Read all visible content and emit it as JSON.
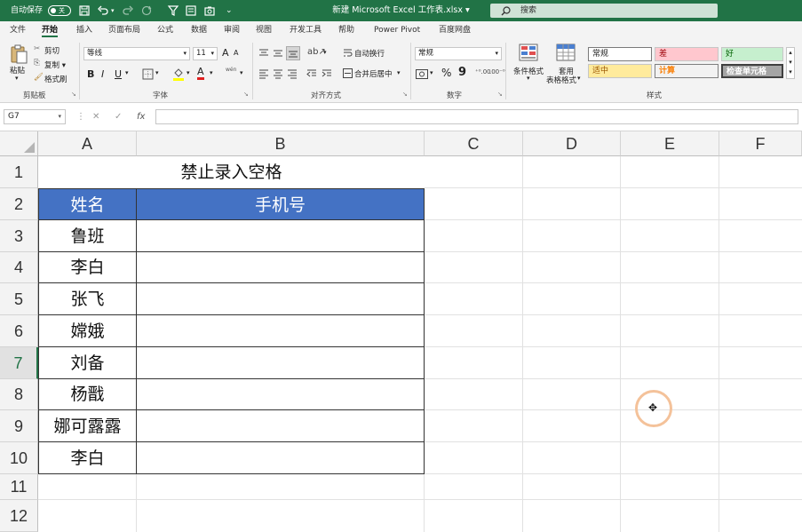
{
  "titlebar": {
    "autosave_label": "自动保存",
    "autosave_state": "关",
    "document_title": "新建 Microsoft Excel 工作表.xlsx  ▾",
    "search_placeholder": "搜索"
  },
  "tabs": [
    "文件",
    "开始",
    "插入",
    "页面布局",
    "公式",
    "数据",
    "审阅",
    "视图",
    "开发工具",
    "帮助",
    "Power Pivot",
    "百度网盘"
  ],
  "ribbon": {
    "clipboard": {
      "paste": "粘贴",
      "cut": "剪切",
      "copy": "复制 ▾",
      "format_painter": "格式刷",
      "group_label": "剪贴板"
    },
    "font": {
      "font_name": "等线",
      "font_size": "11",
      "grow": "A",
      "shrink": "A",
      "bold": "B",
      "italic": "I",
      "underline": "U",
      "wen": "wén",
      "group_label": "字体"
    },
    "alignment": {
      "wrap_text": "自动换行",
      "merge_center": "合并后居中",
      "group_label": "对齐方式"
    },
    "number": {
      "format": "常规",
      "percent": "%",
      "comma": "9",
      "group_label": "数字"
    },
    "styles": {
      "conditional_formatting": "条件格式",
      "format_as_table_line1": "套用",
      "format_as_table_line2": "表格格式",
      "normal": "常规",
      "bad": "差",
      "good": "好",
      "neutral": "适中",
      "calculation": "计算",
      "check_cell": "检查单元格",
      "group_label": "样式"
    }
  },
  "formula_bar": {
    "name_box": "G7",
    "cancel": "✕",
    "enter": "✓",
    "fx": "fx",
    "value": ""
  },
  "sheet": {
    "columns": [
      "A",
      "B",
      "C",
      "D",
      "E",
      "F"
    ],
    "rows": [
      "1",
      "2",
      "3",
      "4",
      "5",
      "6",
      "7",
      "8",
      "9",
      "10",
      "11",
      "12"
    ],
    "selected_row": "7",
    "title": "禁止录入空格",
    "headers": [
      "姓名",
      "手机号"
    ],
    "names": [
      "鲁班",
      "李白",
      "张飞",
      "嫦娥",
      "刘备",
      "杨戬",
      "娜可露露",
      "李白"
    ]
  },
  "colors": {
    "accent": "#217346",
    "header_fill": "#4472c4",
    "bad_fill": "#ffc7ce",
    "bad_text": "#9c0006",
    "good_fill": "#c6efce",
    "good_text": "#006100",
    "neutral_fill": "#ffeb9c",
    "neutral_text": "#9c5700",
    "calc_fill": "#f2f2f2",
    "calc_text": "#fa7d00",
    "check_fill": "#a5a5a5"
  }
}
